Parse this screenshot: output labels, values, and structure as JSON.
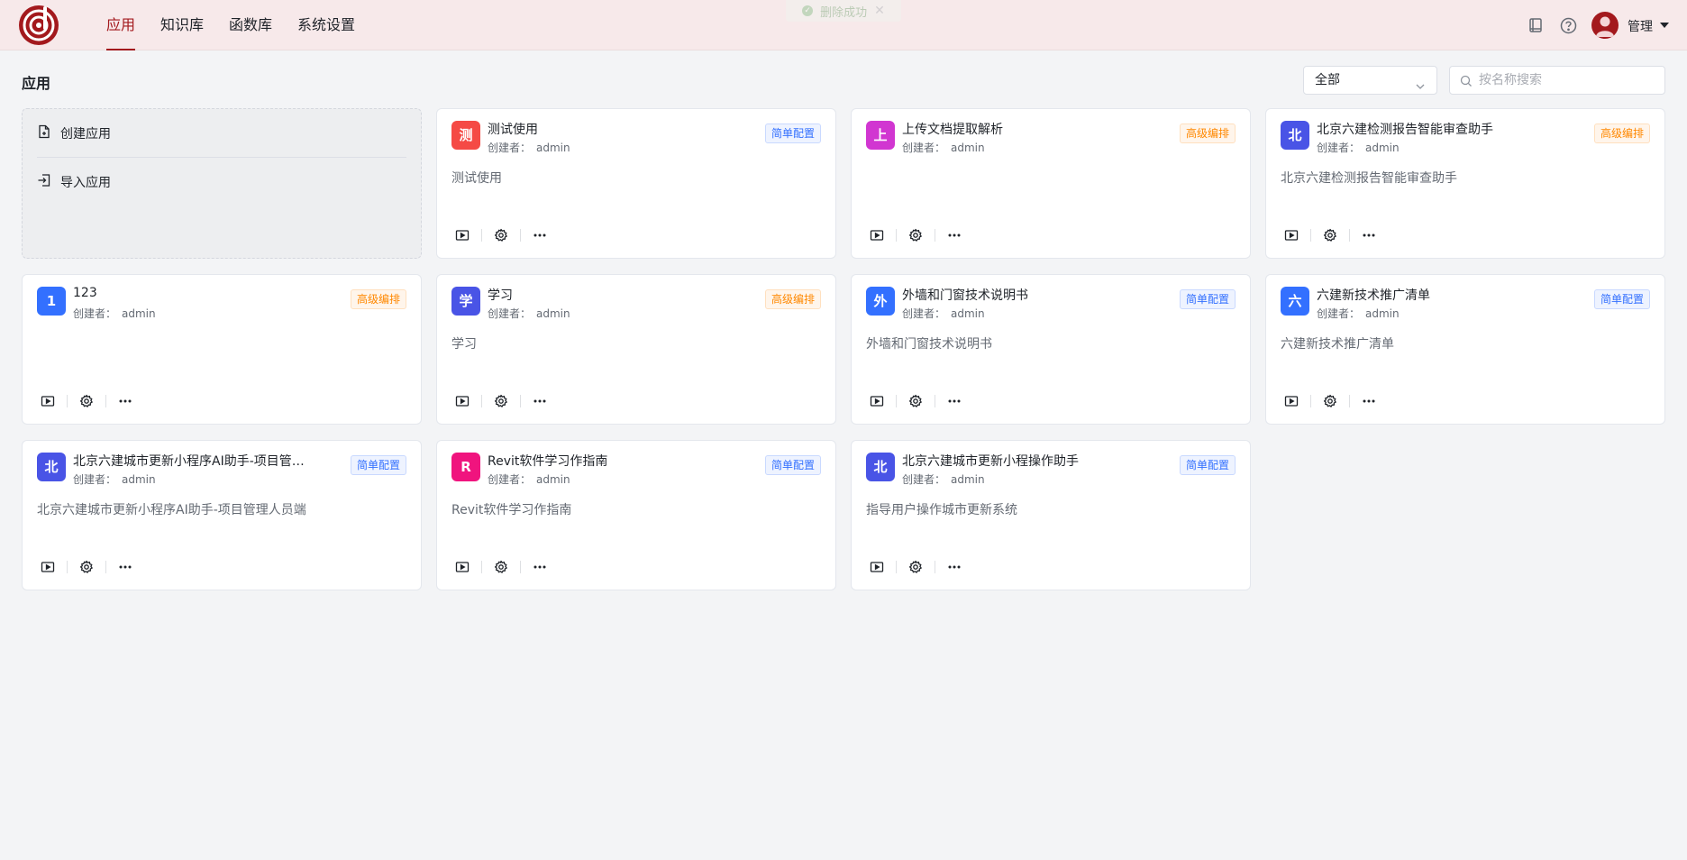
{
  "header": {
    "nav": [
      {
        "label": "应用",
        "active": true
      },
      {
        "label": "知识库",
        "active": false
      },
      {
        "label": "函数库",
        "active": false
      },
      {
        "label": "系统设置",
        "active": false
      }
    ],
    "toast": "删除成功",
    "user_name": "管理",
    "icons": [
      "book-icon",
      "help-icon",
      "user-avatar-icon"
    ]
  },
  "toolbar": {
    "title": "应用",
    "filter_value": "全部",
    "search_placeholder": "按名称搜索"
  },
  "create_card": {
    "create_label": "创建应用",
    "import_label": "导入应用"
  },
  "creator_prefix": "创建者：",
  "apps": [
    {
      "initial": "测",
      "color": "#f54a45",
      "name": "测试使用",
      "creator": "admin",
      "tag": "简单配置",
      "tag_type": "simple",
      "desc": "测试使用"
    },
    {
      "initial": "上",
      "color": "#d136d1",
      "name": "上传文档提取解析",
      "creator": "admin",
      "tag": "高级编排",
      "tag_type": "adv",
      "desc": ""
    },
    {
      "initial": "北",
      "color": "#4954e6",
      "name": "北京六建检测报告智能审查助手",
      "creator": "admin",
      "tag": "高级编排",
      "tag_type": "adv",
      "desc": "北京六建检测报告智能审查助手"
    },
    {
      "initial": "1",
      "color": "#3370ff",
      "name": "123",
      "creator": "admin",
      "tag": "高级编排",
      "tag_type": "adv",
      "desc": ""
    },
    {
      "initial": "学",
      "color": "#4954e6",
      "name": "学习",
      "creator": "admin",
      "tag": "高级编排",
      "tag_type": "adv",
      "desc": "学习"
    },
    {
      "initial": "外",
      "color": "#3370ff",
      "name": "外墙和门窗技术说明书",
      "creator": "admin",
      "tag": "简单配置",
      "tag_type": "simple",
      "desc": "外墙和门窗技术说明书"
    },
    {
      "initial": "六",
      "color": "#3370ff",
      "name": "六建新技术推广清单",
      "creator": "admin",
      "tag": "简单配置",
      "tag_type": "simple",
      "desc": "六建新技术推广清单"
    },
    {
      "initial": "北",
      "color": "#4954e6",
      "name": "北京六建城市更新小程序AI助手-项目管理人员端",
      "creator": "admin",
      "tag": "简单配置",
      "tag_type": "simple",
      "desc": "北京六建城市更新小程序AI助手-项目管理人员端"
    },
    {
      "initial": "R",
      "color": "#f0147e",
      "name": "Revit软件学习作指南",
      "creator": "admin",
      "tag": "简单配置",
      "tag_type": "simple",
      "desc": "Revit软件学习作指南"
    },
    {
      "initial": "北",
      "color": "#4954e6",
      "name": "北京六建城市更新小程操作助手",
      "creator": "admin",
      "tag": "简单配置",
      "tag_type": "simple",
      "desc": "指导用户操作城市更新系统"
    }
  ]
}
